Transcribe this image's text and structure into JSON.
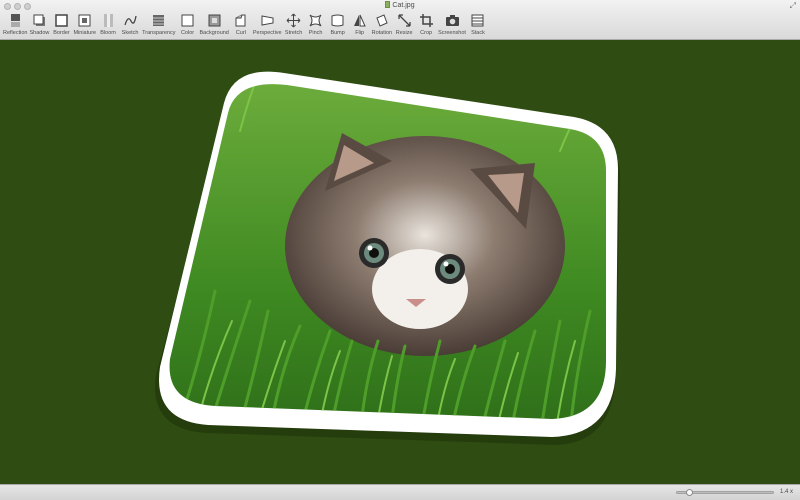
{
  "window": {
    "title": "Cat.jpg"
  },
  "toolbar": {
    "items": [
      {
        "label": "Reflection",
        "icon": "reflection-icon"
      },
      {
        "label": "Shadow",
        "icon": "shadow-icon"
      },
      {
        "label": "Border",
        "icon": "border-icon"
      },
      {
        "label": "Miniature",
        "icon": "miniature-icon"
      },
      {
        "label": "Bloom",
        "icon": "bloom-icon"
      },
      {
        "label": "Sketch",
        "icon": "sketch-icon"
      },
      {
        "label": "Transparency",
        "icon": "transparency-icon"
      },
      {
        "label": "Color",
        "icon": "color-icon"
      },
      {
        "label": "Background",
        "icon": "background-icon"
      },
      {
        "label": "Curl",
        "icon": "curl-icon"
      },
      {
        "label": "Perspective",
        "icon": "perspective-icon"
      },
      {
        "label": "Stretch",
        "icon": "stretch-icon"
      },
      {
        "label": "Pinch",
        "icon": "pinch-icon"
      },
      {
        "label": "Bump",
        "icon": "bump-icon"
      },
      {
        "label": "Flip",
        "icon": "flip-icon"
      },
      {
        "label": "Rotation",
        "icon": "rotation-icon"
      },
      {
        "label": "Resize",
        "icon": "resize-icon"
      },
      {
        "label": "Crop",
        "icon": "crop-icon"
      },
      {
        "label": "Screenshot",
        "icon": "camera-icon"
      },
      {
        "label": "Stack",
        "icon": "stack-icon"
      }
    ]
  },
  "status": {
    "zoom_label": "1.4 x",
    "zoom_fraction": 0.1
  },
  "colors": {
    "canvas_bg": "#2f4d12",
    "border": "#ffffff",
    "grass": "#3e8a24"
  }
}
